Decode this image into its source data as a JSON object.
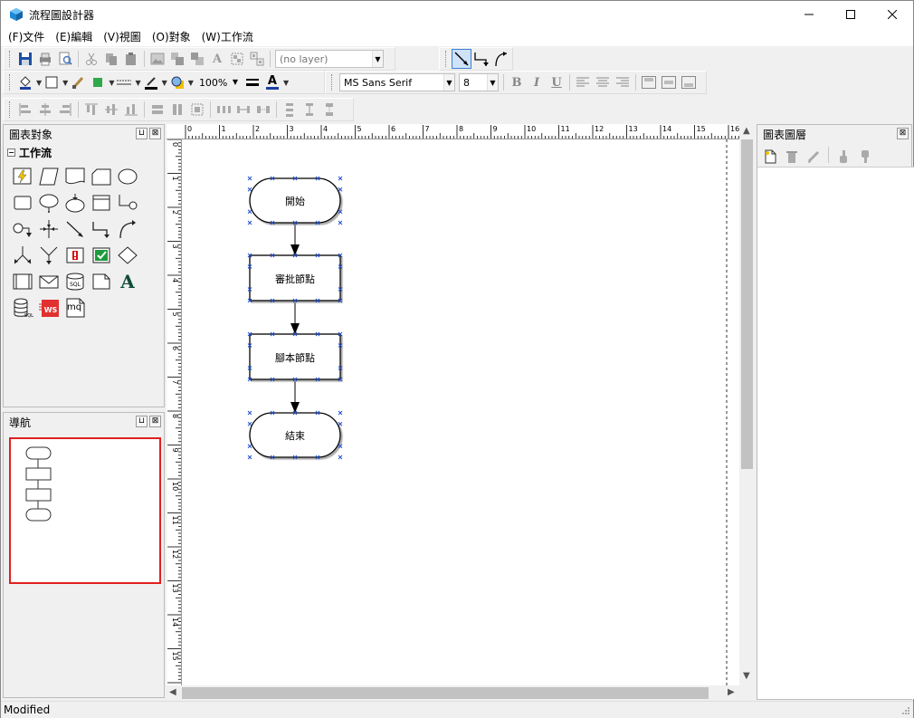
{
  "window": {
    "title": "流程圖設計器"
  },
  "menu": [
    "(F)文件",
    "(E)編輯",
    "(V)視圖",
    "(O)對象",
    "(W)工作流"
  ],
  "toolbar": {
    "layer_combo": "(no layer)",
    "zoom": "100%",
    "font_name": "MS Sans Serif",
    "font_size": "8",
    "bold": "B",
    "italic": "I",
    "underline": "U",
    "text_color_letter": "A"
  },
  "left_panel": {
    "title": "圖表對象",
    "group": "工作流",
    "pin": "⊔",
    "close": "⊠",
    "toggle": "−",
    "text_shape_letter": "A",
    "mq_label": "mq",
    "ws_label": "WS",
    "sql_label": "SQL"
  },
  "nav_panel": {
    "title": "導航"
  },
  "right_panel": {
    "title": "圖表圖層"
  },
  "ruler": {
    "h_labels": [
      "0",
      "1",
      "2",
      "3",
      "4",
      "5",
      "6",
      "7",
      "8",
      "9",
      "10",
      "11",
      "12",
      "13",
      "14",
      "15",
      "16"
    ],
    "v_labels": [
      "0",
      "1",
      "2",
      "3",
      "4",
      "5",
      "6",
      "7",
      "8",
      "9",
      "10",
      "11",
      "12",
      "13",
      "14",
      "15"
    ]
  },
  "flow": {
    "start": "開始",
    "approve": "審批節點",
    "script": "腳本節點",
    "end": "結束"
  },
  "status": {
    "text": "Modified"
  }
}
